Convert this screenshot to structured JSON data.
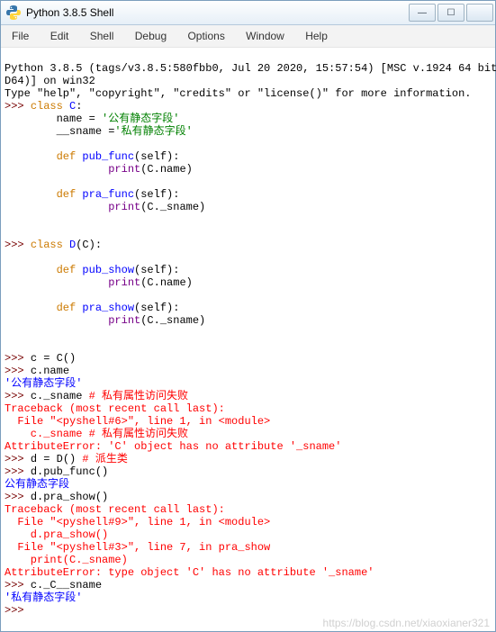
{
  "window": {
    "title": "Python 3.8.5 Shell"
  },
  "win_controls": {
    "min": "—",
    "max": "☐",
    "close": ""
  },
  "menu": {
    "file": "File",
    "edit": "Edit",
    "shell": "Shell",
    "debug": "Debug",
    "options": "Options",
    "window": "Window",
    "help": "Help"
  },
  "banner": {
    "l1": "Python 3.8.5 (tags/v3.8.5:580fbb0, Jul 20 2020, 15:57:54) [MSC v.1924 64 bit",
    "l2": "D64)] on win32",
    "l3": "Type \"help\", \"copyright\", \"credits\" or \"license()\" for more information."
  },
  "p": ">>> ",
  "kw": {
    "class": "class",
    "def": "def",
    "print": "print"
  },
  "code": {
    "cls_c": "C",
    "cls_d": "D",
    "d_base": "(C)",
    "colon": ":",
    "name_assign": "        name = ",
    "name_val": "'公有静态字段'",
    "sname_assign": "        __sname =",
    "sname_val": "'私有静态字段'",
    "pub_func": "pub_func",
    "pra_func": "pra_func",
    "pub_show": "pub_show",
    "pra_show": "pra_show",
    "self": "(self):",
    "print_cname": "(C.name)",
    "print_sname": "(C._sname)",
    "c_assign": "c = C()",
    "c_name": "c.name",
    "c_sname": "c._sname ",
    "c_sname_cmt": "# 私有属性访问失败",
    "d_assign": "d = D() ",
    "d_assign_cmt": "# 派生类",
    "d_pubfunc": "d.pub_func()",
    "d_prashow": "d.pra_show()",
    "c_mangled": "c._C__sname"
  },
  "out": {
    "name": "'公有静态字段'",
    "pubfunc": "公有静态字段",
    "mangled": "'私有静态字段'"
  },
  "tb": {
    "head": "Traceback (most recent call last):",
    "f6": "  File \"<pyshell#6>\", line 1, in <module>",
    "f6b": "    c._sname # 私有属性访问失败",
    "ae1": "AttributeError: 'C' object has no attribute '_sname'",
    "f9": "  File \"<pyshell#9>\", line 1, in <module>",
    "f9b": "    d.pra_show()",
    "f3": "  File \"<pyshell#3>\", line 7, in pra_show",
    "f3b": "    print(C._sname)",
    "ae2": "AttributeError: type object 'C' has no attribute '_sname'"
  },
  "watermark": "https://blog.csdn.net/xiaoxianer321"
}
